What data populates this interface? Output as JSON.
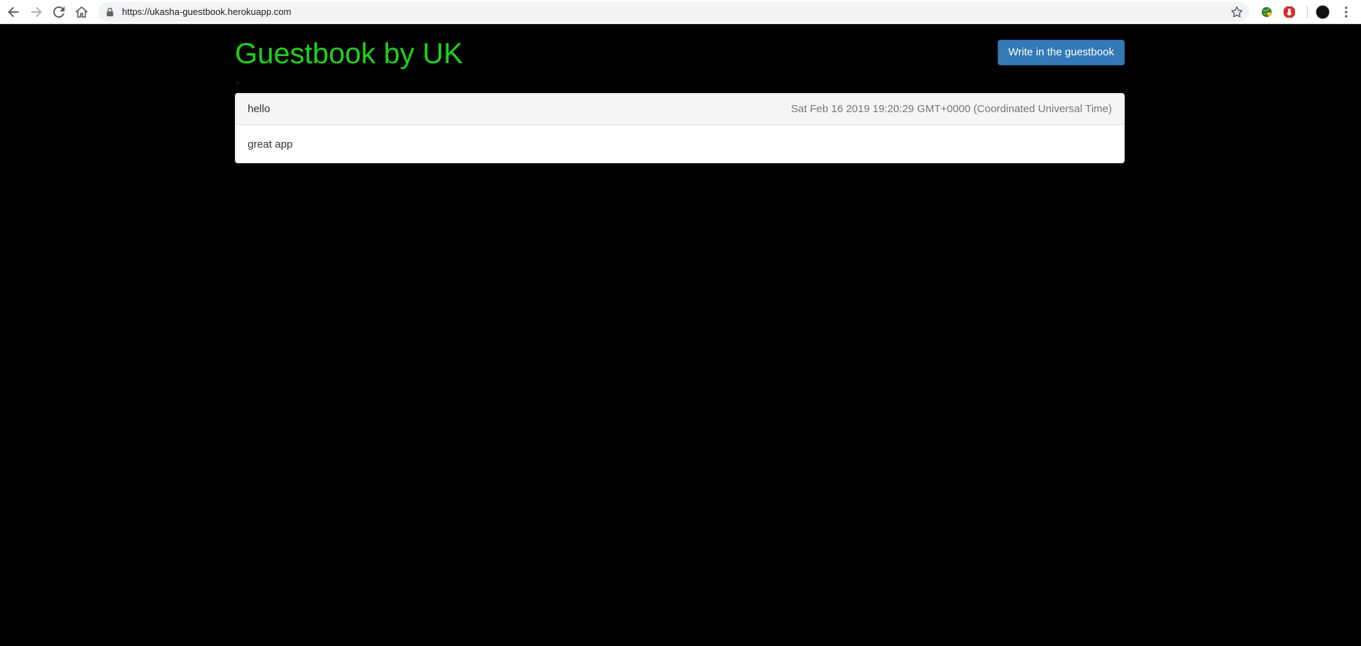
{
  "browser": {
    "url": "https://ukasha-guestbook.herokuapp.com",
    "icons": {
      "back": "back-arrow-icon",
      "forward": "forward-arrow-icon",
      "reload": "reload-icon",
      "home": "home-icon",
      "lock": "lock-icon",
      "bookmark": "star-icon",
      "extension_1": "extension-globe-icon",
      "extension_2": "extension-stop-hand-icon",
      "profile": "profile-avatar-icon",
      "menu": "kebab-menu-icon"
    }
  },
  "header": {
    "title": "Guestbook by UK",
    "title_color": "#1fd01f",
    "write_button_label": "Write in the guestbook",
    "button_color": "#337ab7",
    "stray_text": ">"
  },
  "entries": [
    {
      "title": "hello",
      "date": "Sat Feb 16 2019 19:20:29 GMT+0000 (Coordinated Universal Time)",
      "message": "great app"
    }
  ]
}
